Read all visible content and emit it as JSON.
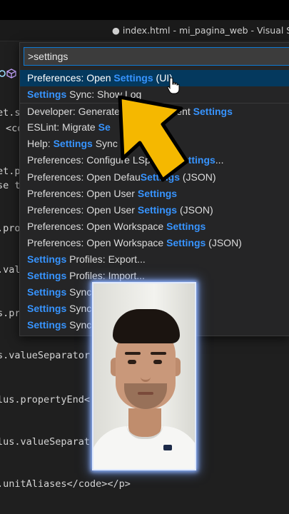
{
  "window": {
    "title": "● index.html - mi_pagina_web - Visual Studio"
  },
  "command_palette": {
    "query": ">settings",
    "items": [
      {
        "pre": "Preferences: Open ",
        "hl": "Settings",
        "post": " (UI)",
        "selected": true
      },
      {
        "pre": "",
        "hl": "Settings",
        "post": " Sync: Show Log",
        "selected": false
      },
      {
        "pre": "Developer: Generate ",
        "hl": "",
        "post": "e From Current ",
        "hl2": "Settings",
        "separator": true
      },
      {
        "pre": "ESLint: Migrate ",
        "hl": "Se",
        "post": ""
      },
      {
        "pre": "Help: ",
        "hl": "Settings",
        "post": " Sync"
      },
      {
        "pre": "Preferences: Configure L",
        "hl": "",
        "post": "Specific ",
        "hl2": "Settings",
        "post2": "..."
      },
      {
        "pre": "Preferences: Open Defau",
        "hl": "Settings",
        "post": " (JSON)"
      },
      {
        "pre": "Preferences: Open User ",
        "hl": "Settings",
        "post": ""
      },
      {
        "pre": "Preferences: Open User ",
        "hl": "Settings",
        "post": " (JSON)"
      },
      {
        "pre": "Preferences: Open Workspace ",
        "hl": "Settings",
        "post": ""
      },
      {
        "pre": "Preferences: Open Workspace ",
        "hl": "Settings",
        "post": " (JSON)"
      },
      {
        "pre": "",
        "hl": "Settings",
        "post": " Profiles: Export..."
      },
      {
        "pre": "",
        "hl": "Settings",
        "post": " Profiles: Import..."
      },
      {
        "pre": "",
        "hl": "Settings",
        "post": " Sync:",
        "post2": "ler"
      },
      {
        "pre": "",
        "hl": "Settings",
        "post": " Sync:"
      },
      {
        "pre": "",
        "hl": "Settings",
        "post": " Sync:"
      }
    ]
  },
  "editor": {
    "lines": [
      {
        "text": "et.s"
      },
      {
        "text": "<co"
      },
      {
        "text": "et.p"
      },
      {
        "text": "se t"
      },
      {
        "text": ".pro"
      },
      {
        "text": ".val"
      },
      {
        "text": "s.pr"
      },
      {
        "text": "s.valueSeparator"
      },
      {
        "text": "lus.propertyEnd<"
      },
      {
        "text": "lus.valueSeparat"
      },
      {
        "text": ".unitAliases</code></p>"
      }
    ]
  },
  "overlay": {
    "arrow": "yellow-pointer-arrow",
    "cursor": "hand-pointer-icon",
    "webcam": "presenter-webcam"
  },
  "colors": {
    "highlight": "#3794ff",
    "selection": "#04395e",
    "focus_border": "#0e7ad3",
    "arrow_fill": "#f5b800"
  }
}
